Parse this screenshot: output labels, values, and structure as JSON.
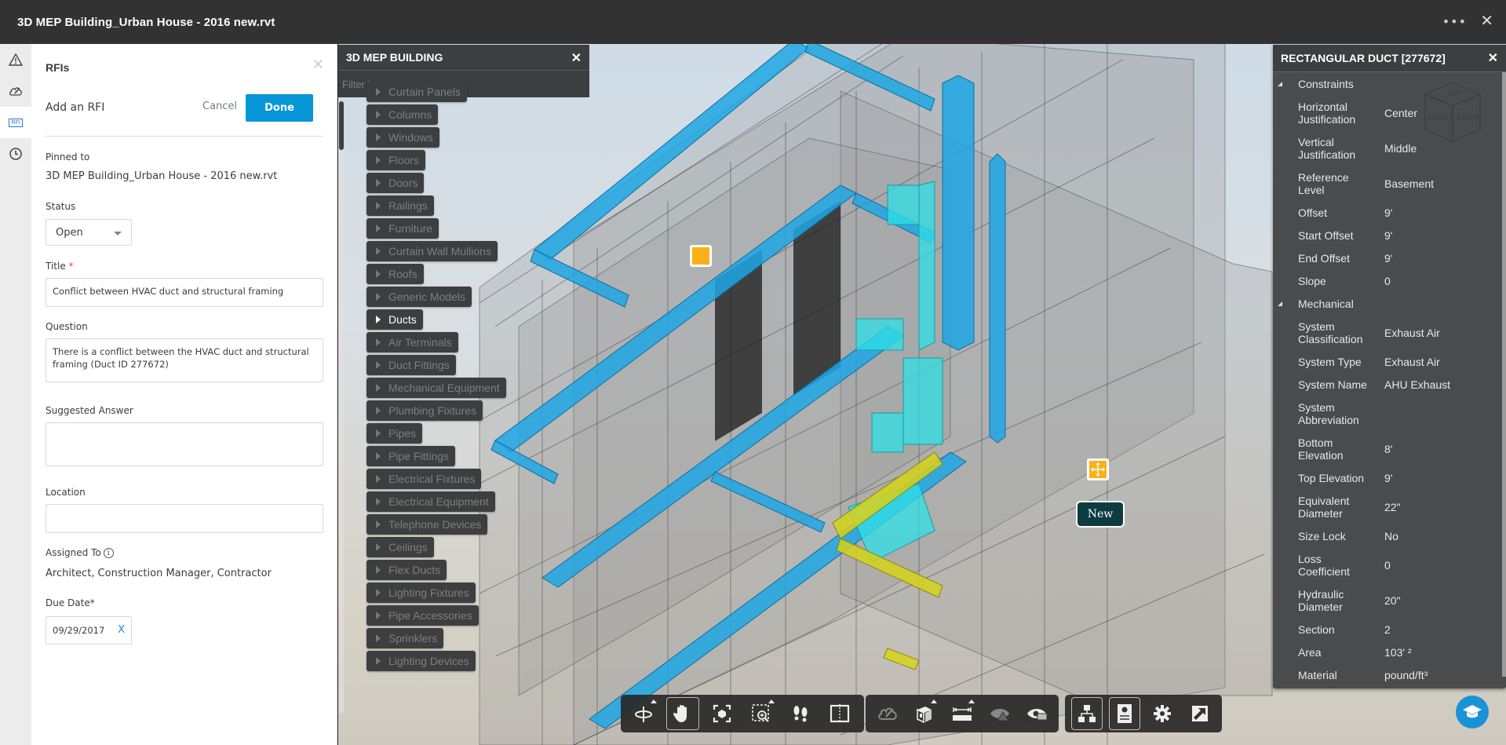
{
  "app": {
    "title": "3D MEP Building_Urban House - 2016 new.rvt",
    "more_label": "•••",
    "close_label": "✕"
  },
  "rail": {
    "items": [
      {
        "name": "issues",
        "icon": "warning-icon"
      },
      {
        "name": "markups",
        "icon": "markup-cloud-icon"
      },
      {
        "name": "rfis",
        "icon": "rfi-icon",
        "badge": "RFI",
        "active": true
      },
      {
        "name": "history",
        "icon": "clock-icon"
      }
    ]
  },
  "rfi_panel": {
    "header": "RFIs",
    "close_label": "✕",
    "subheader": "Add an RFI",
    "cancel_label": "Cancel",
    "done_label": "Done",
    "pinned_to_label": "Pinned to",
    "pinned_to_value": "3D MEP Building_Urban House - 2016 new.rvt",
    "status_label": "Status",
    "status_value": "Open",
    "title_label": "Title",
    "title_required": "*",
    "title_value": "Conflict between HVAC duct and structural framing",
    "question_label": "Question",
    "question_value": "There is a conflict between the HVAC duct and structural framing (Duct ID 277672)",
    "suggested_answer_label": "Suggested Answer",
    "suggested_answer_value": "",
    "location_label": "Location",
    "location_value": "",
    "assigned_to_label": "Assigned To",
    "assigned_to_value": "Architect, Construction Manager, Contractor",
    "due_date_label": "Due Date*",
    "due_date_value": "09/29/2017",
    "due_date_clear": "X"
  },
  "model_browser": {
    "title": "3D MEP BUILDING",
    "close_label": "✕",
    "filter_placeholder": "Filter by name",
    "items": [
      {
        "label": "Curtain Panels",
        "active": false
      },
      {
        "label": "Columns",
        "active": false
      },
      {
        "label": "Windows",
        "active": false
      },
      {
        "label": "Floors",
        "active": false
      },
      {
        "label": "Doors",
        "active": false
      },
      {
        "label": "Railings",
        "active": false
      },
      {
        "label": "Furniture",
        "active": false
      },
      {
        "label": "Curtain Wall Mullions",
        "active": false
      },
      {
        "label": "Roofs",
        "active": false
      },
      {
        "label": "Generic Models",
        "active": false
      },
      {
        "label": "Ducts",
        "active": true
      },
      {
        "label": "Air Terminals",
        "active": false
      },
      {
        "label": "Duct Fittings",
        "active": false
      },
      {
        "label": "Mechanical Equipment",
        "active": false
      },
      {
        "label": "Plumbing Fixtures",
        "active": false
      },
      {
        "label": "Pipes",
        "active": false
      },
      {
        "label": "Pipe Fittings",
        "active": false
      },
      {
        "label": "Electrical Fixtures",
        "active": false
      },
      {
        "label": "Electrical Equipment",
        "active": false
      },
      {
        "label": "Telephone Devices",
        "active": false
      },
      {
        "label": "Ceilings",
        "active": false
      },
      {
        "label": "Flex Ducts",
        "active": false
      },
      {
        "label": "Lighting Fixtures",
        "active": false
      },
      {
        "label": "Pipe Accessories",
        "active": false
      },
      {
        "label": "Sprinklers",
        "active": false
      },
      {
        "label": "Lighting Devices",
        "active": false
      }
    ]
  },
  "properties": {
    "title": "RECTANGULAR DUCT [277672]",
    "close_label": "✕",
    "categories": [
      {
        "name": "Constraints",
        "rows": [
          {
            "key": "Horizontal Justification",
            "value": "Center"
          },
          {
            "key": "Vertical Justification",
            "value": "Middle"
          },
          {
            "key": "Reference Level",
            "value": "Basement"
          },
          {
            "key": "Offset",
            "value": "9'"
          },
          {
            "key": "Start Offset",
            "value": "9'"
          },
          {
            "key": "End Offset",
            "value": "9'"
          },
          {
            "key": "Slope",
            "value": "0"
          }
        ]
      },
      {
        "name": "Mechanical",
        "rows": [
          {
            "key": "System Classification",
            "value": "Exhaust Air"
          },
          {
            "key": "System Type",
            "value": "Exhaust Air"
          },
          {
            "key": "System Name",
            "value": "AHU Exhaust"
          },
          {
            "key": "System Abbreviation",
            "value": ""
          },
          {
            "key": "Bottom Elevation",
            "value": "8'"
          },
          {
            "key": "Top Elevation",
            "value": "9'"
          },
          {
            "key": "Equivalent Diameter",
            "value": "22\""
          },
          {
            "key": "Size Lock",
            "value": "No"
          },
          {
            "key": "Loss Coefficient",
            "value": "0"
          },
          {
            "key": "Hydraulic Diameter",
            "value": "20\""
          },
          {
            "key": "Section",
            "value": "2"
          },
          {
            "key": "Area",
            "value": "103' ²"
          },
          {
            "key": "Material",
            "value": "pound/ft³"
          }
        ]
      }
    ]
  },
  "viewcube": {
    "top": "TOP",
    "front": "FRONT",
    "right": "RIGHT"
  },
  "markers": {
    "new_label": "New"
  },
  "toolbar": {
    "group1": [
      {
        "name": "orbit",
        "icon": "orbit-icon",
        "flyout": true,
        "selected": false
      },
      {
        "name": "pan",
        "icon": "pan-hand-icon",
        "flyout": false,
        "selected": true
      },
      {
        "name": "fit-to-view",
        "icon": "fit-to-view-icon",
        "flyout": false,
        "selected": false
      },
      {
        "name": "zoom-window",
        "icon": "zoom-window-icon",
        "flyout": true,
        "selected": false
      },
      {
        "name": "first-person",
        "icon": "footsteps-icon",
        "flyout": false,
        "selected": false
      },
      {
        "name": "section",
        "icon": "section-icon",
        "flyout": false,
        "selected": false
      }
    ],
    "group2": [
      {
        "name": "markup",
        "icon": "markup-cloud-icon",
        "flyout": false
      },
      {
        "name": "explode",
        "icon": "explode-icon",
        "flyout": true
      },
      {
        "name": "measure",
        "icon": "measure-icon",
        "flyout": true
      },
      {
        "name": "issues",
        "icon": "eye-warning-icon",
        "flyout": false
      },
      {
        "name": "rfi-view",
        "icon": "eye-rfi-icon",
        "flyout": false
      }
    ],
    "group3": [
      {
        "name": "model-browser",
        "icon": "model-tree-icon",
        "selected": true
      },
      {
        "name": "properties",
        "icon": "properties-icon",
        "selected": true
      },
      {
        "name": "settings",
        "icon": "gear-icon",
        "selected": false
      },
      {
        "name": "fullscreen",
        "icon": "fullscreen-icon",
        "selected": false
      }
    ]
  },
  "colors": {
    "accent": "#0696d7",
    "pin": "#fbb017",
    "duct_blue": "#1fa7e4",
    "duct_cyan": "#2fe0e6",
    "duct_selected": "#d6d21a"
  }
}
